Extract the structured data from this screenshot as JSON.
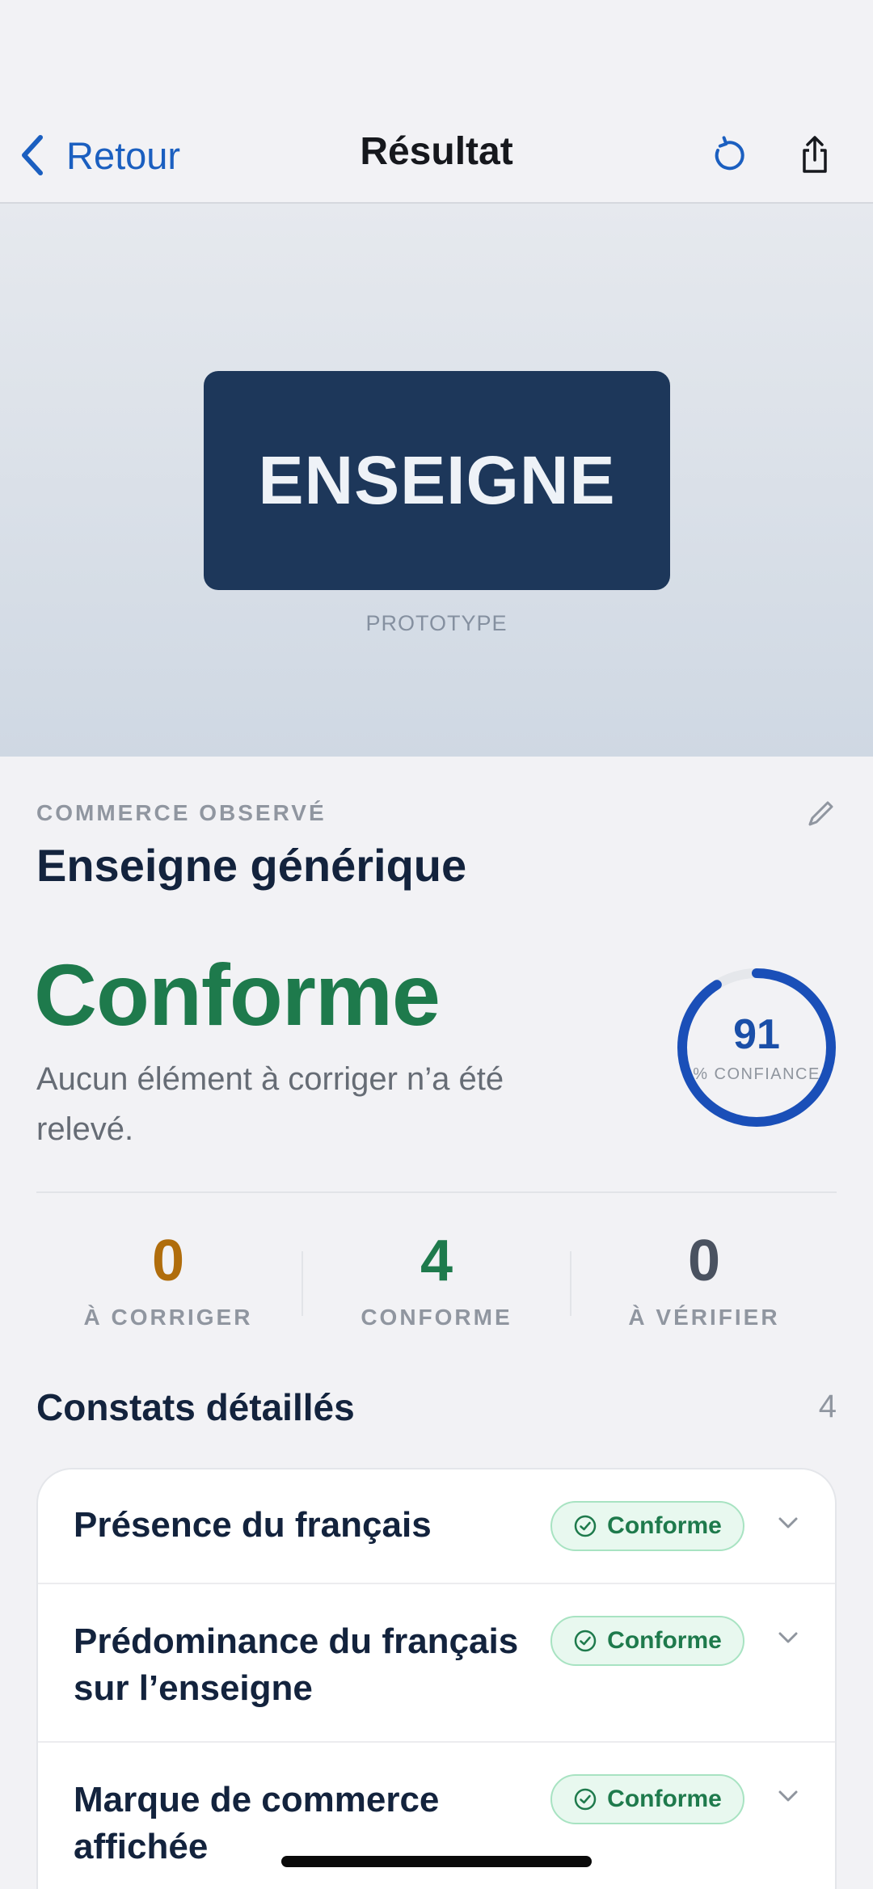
{
  "nav": {
    "back_label": "Retour",
    "title": "Résultat",
    "refresh_icon": "refresh-icon",
    "share_icon": "share-icon",
    "accent": "#1b5fc0"
  },
  "hero": {
    "sign_text": "ENSEIGNE",
    "caption": "PROTOTYPE"
  },
  "commerce": {
    "eyebrow": "COMMERCE OBSERVÉ",
    "name": "Enseigne générique"
  },
  "verdict": {
    "status": "Conforme",
    "description": "Aucun élément à corriger n’a été relevé.",
    "color": "#1e7a4c"
  },
  "confidence": {
    "value": "91",
    "label": "% CONFIANCE",
    "fraction": 0.91,
    "color": "#1a4fb8"
  },
  "stats": [
    {
      "value": "0",
      "label": "À CORRIGER",
      "color": "#b06d0c"
    },
    {
      "value": "4",
      "label": "CONFORME",
      "color": "#1e7a4c"
    },
    {
      "value": "0",
      "label": "À VÉRIFIER",
      "color": "#4a5260"
    }
  ],
  "details": {
    "title": "Constats détaillés",
    "count": "4",
    "items": [
      {
        "title": "Présence du français",
        "status": "Conforme"
      },
      {
        "title": "Prédominance du français sur l’enseigne",
        "status": "Conforme"
      },
      {
        "title": "Marque de commerce affichée",
        "status": "Conforme"
      }
    ]
  }
}
